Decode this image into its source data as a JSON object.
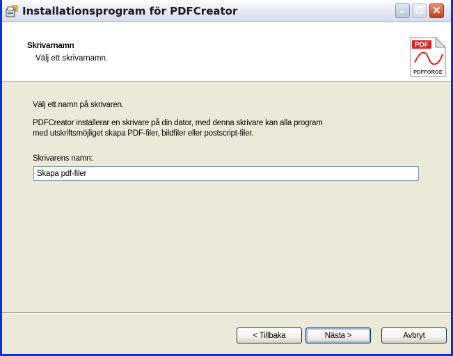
{
  "window": {
    "title": "Installationsprogram för PDFCreator",
    "controls": {
      "minimize_icon": "minimize-icon",
      "maximize_icon": "maximize-icon",
      "close_icon": "close-icon"
    }
  },
  "header": {
    "title": "Skrivarnamn",
    "subtitle": "Välj ett skrivarnamn.",
    "logo": {
      "top_label": "PDF",
      "bottom_label": "PDFFORGE"
    }
  },
  "content": {
    "instruction": "Välj ett namn på skrivaren.",
    "description_line1": "PDFCreator installerar en skrivare på din dator, med denna skrivare kan alla program",
    "description_line2": "med utskriftsmöjliget skapa PDF-filer, bildfiler eller postscript-filer.",
    "printer_name_label": "Skrivarens namn:",
    "printer_name_value": "Skapa pdf-filer"
  },
  "buttons": {
    "back": "< Tillbaka",
    "next": "Nästa >",
    "cancel": "Avbryt"
  },
  "colors": {
    "frame": "#0831d9",
    "dialog_bg": "#ece9d8",
    "header_bg": "#ffffff",
    "close_button": "#c7411c",
    "logo_red": "#e0201c"
  }
}
